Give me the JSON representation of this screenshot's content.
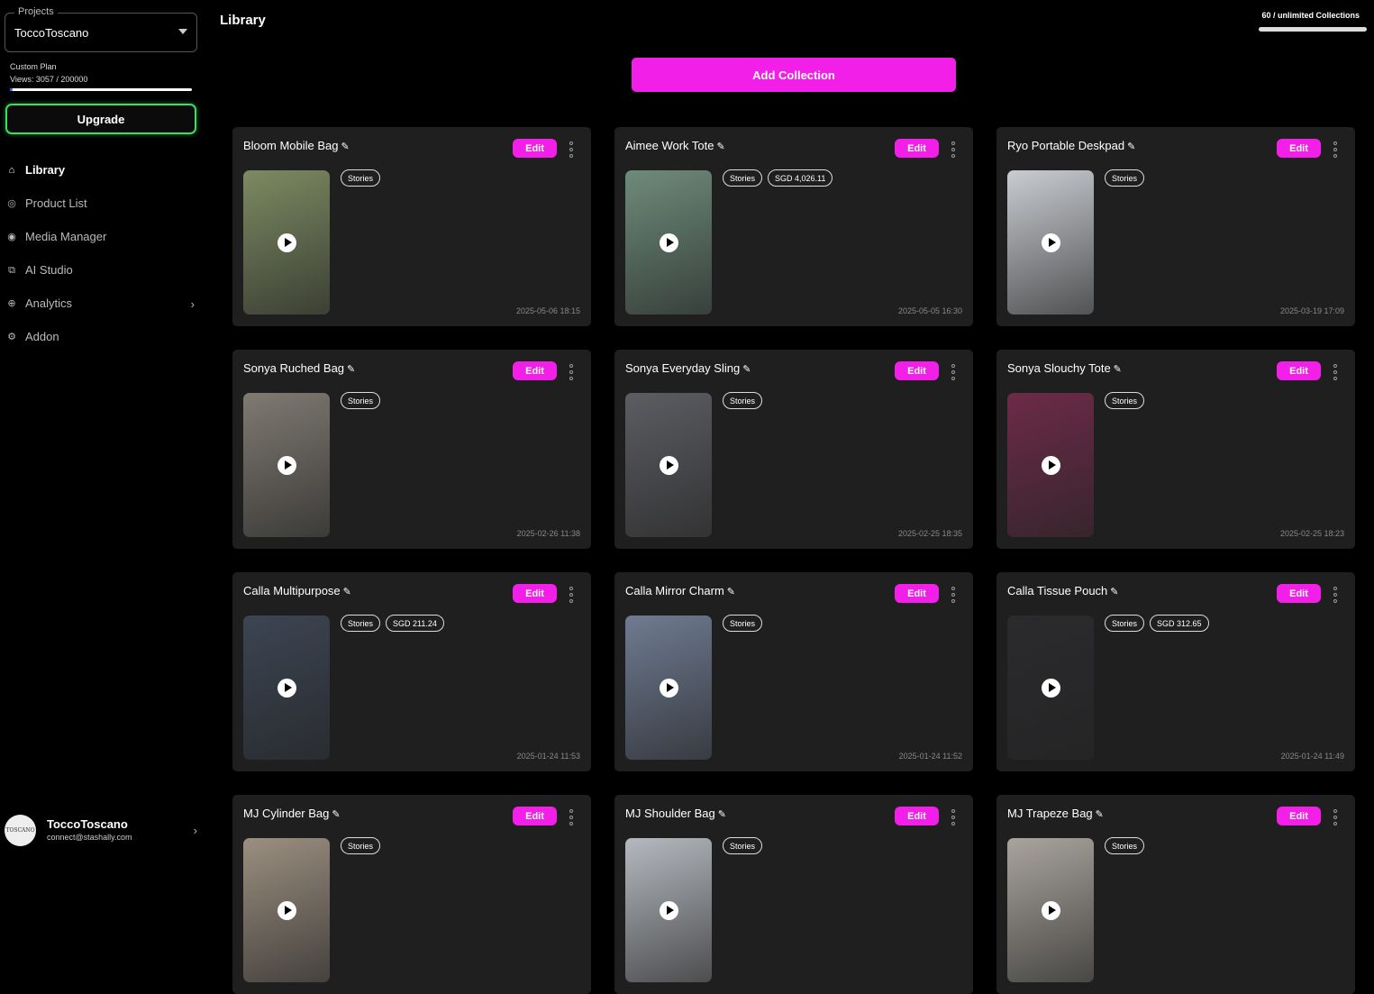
{
  "sidebar": {
    "project_legend": "Projects",
    "project_name": "ToccoToscano",
    "plan_name": "Custom Plan",
    "views_text": "Views: 3057 / 200000",
    "views_fraction": 0.015,
    "upgrade_label": "Upgrade",
    "nav": [
      {
        "label": "Library",
        "icon": "home-icon",
        "active": true
      },
      {
        "label": "Product List",
        "icon": "product-icon"
      },
      {
        "label": "Media Manager",
        "icon": "media-icon"
      },
      {
        "label": "AI Studio",
        "icon": "ai-icon"
      },
      {
        "label": "Analytics",
        "icon": "analytics-icon",
        "chevron": true
      },
      {
        "label": "Addon",
        "icon": "addon-icon"
      }
    ],
    "user": {
      "name": "ToccoToscano",
      "email": "connect@stashally.com",
      "avatar_text": "TOSCANO"
    }
  },
  "header": {
    "title": "Library",
    "collections_count": "60 / unlimited Collections",
    "add_collection_label": "Add Collection"
  },
  "collections": [
    {
      "title": "Bloom Mobile Bag",
      "tags": [
        "Stories"
      ],
      "date": "2025-05-06 18:15",
      "thumb": "#7d8a62"
    },
    {
      "title": "Aimee Work Tote",
      "tags": [
        "Stories",
        "SGD 4,026.11"
      ],
      "date": "2025-05-05 16:30",
      "thumb": "#6e8b7b"
    },
    {
      "title": "Ryo Portable Deskpad",
      "tags": [
        "Stories"
      ],
      "date": "2025-03-19 17:09",
      "thumb": "#c9ccd1"
    },
    {
      "title": "Sonya Ruched Bag",
      "tags": [
        "Stories"
      ],
      "date": "2025-02-26 11:38",
      "thumb": "#7f7a72"
    },
    {
      "title": "Sonya Everyday Sling",
      "tags": [
        "Stories"
      ],
      "date": "2025-02-25 18:35",
      "thumb": "#5c5d62"
    },
    {
      "title": "Sonya Slouchy Tote",
      "tags": [
        "Stories"
      ],
      "date": "2025-02-25 18:23",
      "thumb": "#6c2b48"
    },
    {
      "title": "Calla Multipurpose",
      "tags": [
        "Stories",
        "SGD 211.24"
      ],
      "date": "2025-01-24 11:53",
      "thumb": "#3c4553"
    },
    {
      "title": "Calla Mirror Charm",
      "tags": [
        "Stories"
      ],
      "date": "2025-01-24 11:52",
      "thumb": "#6f7b91"
    },
    {
      "title": "Calla Tissue Pouch",
      "tags": [
        "Stories",
        "SGD 312.65"
      ],
      "date": "2025-01-24 11:49",
      "thumb": "#2b2b2e"
    },
    {
      "title": "MJ Cylinder Bag",
      "tags": [
        "Stories"
      ],
      "date": "",
      "thumb": "#9b8f80"
    },
    {
      "title": "MJ Shoulder Bag",
      "tags": [
        "Stories"
      ],
      "date": "",
      "thumb": "#b5b9bf"
    },
    {
      "title": "MJ Trapeze Bag",
      "tags": [
        "Stories"
      ],
      "date": "",
      "thumb": "#a9a49d"
    }
  ],
  "labels": {
    "edit": "Edit"
  }
}
